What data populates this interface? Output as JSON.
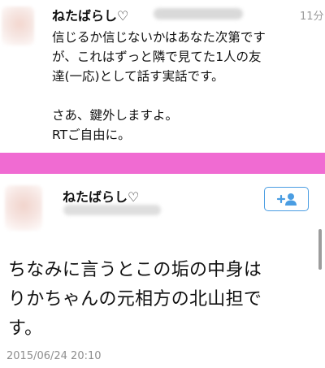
{
  "tweet1": {
    "name": "ねたばらし♡",
    "time": "11分",
    "body": "信じるか信じないかはあなた次第です\nが、これはずっと隣で見てた1人の友\n達(一応)として話す実話です。\n\nさあ、鍵外しますよ。\nRTご自由に。"
  },
  "tweet2": {
    "name": "ねたばらし♡",
    "follow_icon": "add-user-icon",
    "body": "ちなみに言うとこの垢の中身は\nりかちゃんの元相方の北山担で\nす。",
    "date": "2015/06/24 20:10"
  },
  "colors": {
    "accent": "#4a9de2",
    "separator": "#f06bd2",
    "muted": "#9a9a9a"
  }
}
